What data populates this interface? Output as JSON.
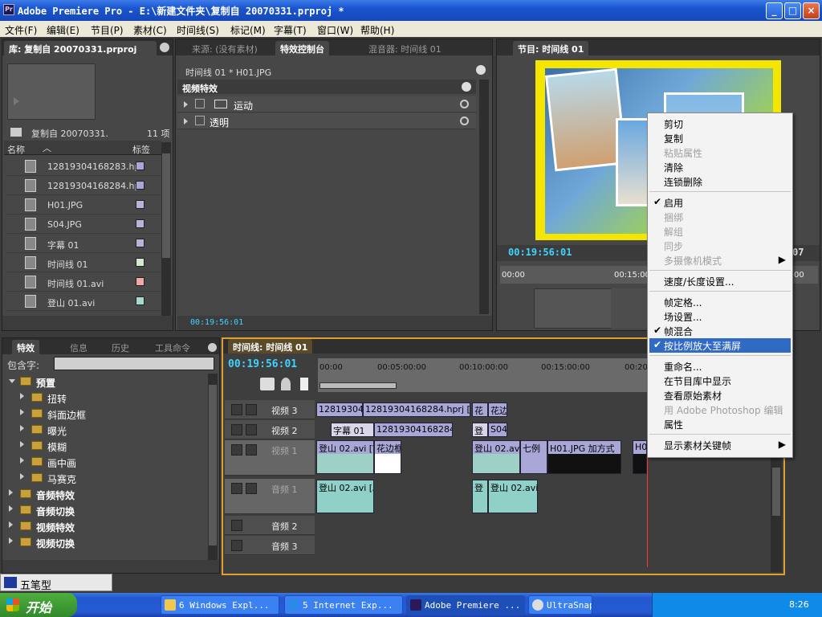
{
  "window": {
    "icon_label": "Pr",
    "title": "Adobe Premiere Pro  -  E:\\新建文件夹\\复制自 20070331.prproj *",
    "btn_min": "_",
    "btn_max": "□",
    "btn_close": "×"
  },
  "menu": [
    "文件(F)",
    "编辑(E)",
    "节目(P)",
    "素材(C)",
    "时间线(S)",
    "标记(M)",
    "字幕(T)",
    "窗口(W)",
    "帮助(H)"
  ],
  "project_panel": {
    "tab": "库: 复制自 20070331.prproj",
    "bin_name": "复制自 20070331.",
    "item_count": "11 项",
    "col_name": "名称",
    "col_label": "标签",
    "items": [
      {
        "name": "12819304168283.hpr",
        "color": "#a9a7d8"
      },
      {
        "name": "12819304168284.hpr",
        "color": "#a9a7d8"
      },
      {
        "name": "H01.JPG",
        "color": "#b7b3d9"
      },
      {
        "name": "S04.JPG",
        "color": "#b7b3d9"
      },
      {
        "name": "字幕 01",
        "color": "#b7b3d9"
      },
      {
        "name": "时间线 01",
        "color": "#d4e8d2"
      },
      {
        "name": "时间线 01.avi",
        "color": "#f0a8a8"
      },
      {
        "name": "登山 01.avi",
        "color": "#a8d8d0"
      }
    ]
  },
  "effect_controls": {
    "tabs": [
      "来源: (没有素材)",
      "特效控制台",
      "混音器: 时间线 01"
    ],
    "header": "时间线 01 * H01.JPG",
    "section": "视频特效",
    "rows": [
      "运动",
      "透明"
    ],
    "timecode": "00:19:56:01"
  },
  "program_monitor": {
    "tab": "节目: 时间线 01",
    "timecode": "00:19:56:01",
    "end_timecode": "07",
    "ruler": [
      "00:00",
      "00:15:00",
      "00"
    ]
  },
  "effects_panel": {
    "tabs": [
      "特效",
      "信息",
      "历史",
      "工具命令"
    ],
    "search_label": "包含字:",
    "items": [
      {
        "name": "预置",
        "level": 0,
        "open": true
      },
      {
        "name": "扭转",
        "level": 1
      },
      {
        "name": "斜面边框",
        "level": 1
      },
      {
        "name": "曝光",
        "level": 1
      },
      {
        "name": "模糊",
        "level": 1
      },
      {
        "name": "画中画",
        "level": 1
      },
      {
        "name": "马赛克",
        "level": 1
      },
      {
        "name": "音频特效",
        "level": 0
      },
      {
        "name": "音频切换",
        "level": 0
      },
      {
        "name": "视频特效",
        "level": 0
      },
      {
        "name": "视频切换",
        "level": 0
      }
    ]
  },
  "timeline": {
    "tab": "时间线: 时间线 01",
    "timecode": "00:19:56:01",
    "ruler": [
      "00:00",
      "00:05:00:00",
      "00:10:00:00",
      "00:15:00:00",
      "00:20"
    ],
    "tracks": [
      "视频 3",
      "视频 2",
      "视频 1",
      "音频 1",
      "音频 2",
      "音频 3"
    ],
    "clips": {
      "v3_a": "128193041",
      "v3_b": "12819304168284.hprj [9.7",
      "v3_c": "花",
      "v3_d": "花边",
      "v2_a": "字幕 01",
      "v2_b": "12819304168284.h",
      "v2_c": "登",
      "v2_d": "S04",
      "v1_a": "登山 02.avi [V",
      "v1_b": "花边框",
      "v1_c": "登山 02.avi",
      "v1_d": "七例",
      "v1_e": "H01.JPG 加方式",
      "v1_f": "H0",
      "a1_a": "登山 02.avi [A",
      "a1_b": "登",
      "a1_c": "登山 02.avi"
    }
  },
  "context_menu": {
    "items": [
      {
        "label": "剪切",
        "state": "normal"
      },
      {
        "label": "复制",
        "state": "normal"
      },
      {
        "label": "粘贴属性",
        "state": "disabled"
      },
      {
        "label": "清除",
        "state": "normal"
      },
      {
        "label": "连锁删除",
        "state": "normal"
      },
      {
        "sep": true
      },
      {
        "label": "启用",
        "state": "checked"
      },
      {
        "label": "捆绑",
        "state": "disabled"
      },
      {
        "label": "解组",
        "state": "disabled"
      },
      {
        "label": "同步",
        "state": "disabled"
      },
      {
        "label": "多摄像机模式",
        "state": "disabled",
        "submenu": true
      },
      {
        "sep": true
      },
      {
        "label": "速度/长度设置...",
        "state": "normal"
      },
      {
        "sep": true
      },
      {
        "label": "帧定格...",
        "state": "normal"
      },
      {
        "label": "场设置...",
        "state": "normal"
      },
      {
        "label": "帧混合",
        "state": "checked"
      },
      {
        "label": "按比例放大至满屏",
        "state": "checked-selected"
      },
      {
        "sep": true
      },
      {
        "label": "重命名...",
        "state": "normal"
      },
      {
        "label": "在节目库中显示",
        "state": "normal"
      },
      {
        "label": "查看原始素材",
        "state": "normal"
      },
      {
        "label": "用 Adobe Photoshop 编辑",
        "state": "disabled"
      },
      {
        "label": "属性",
        "state": "normal"
      },
      {
        "sep": true
      },
      {
        "label": "显示素材关键帧",
        "state": "normal",
        "submenu": true
      }
    ]
  },
  "ime_bar": {
    "label": "五笔型"
  },
  "taskbar": {
    "start": "开始",
    "buttons": [
      {
        "label": "6 Windows Expl...",
        "active": false
      },
      {
        "label": "5 Internet Exp...",
        "active": false
      },
      {
        "label": "Adobe Premiere ...",
        "active": true
      },
      {
        "label": "UltraSnap",
        "active": false
      }
    ],
    "clock": "8:26"
  },
  "colors": {
    "accent_timecode": "#3fd4ff",
    "selection": "#316ac5",
    "playhead": "#ff3333",
    "panel_frame": "#e0a030"
  }
}
